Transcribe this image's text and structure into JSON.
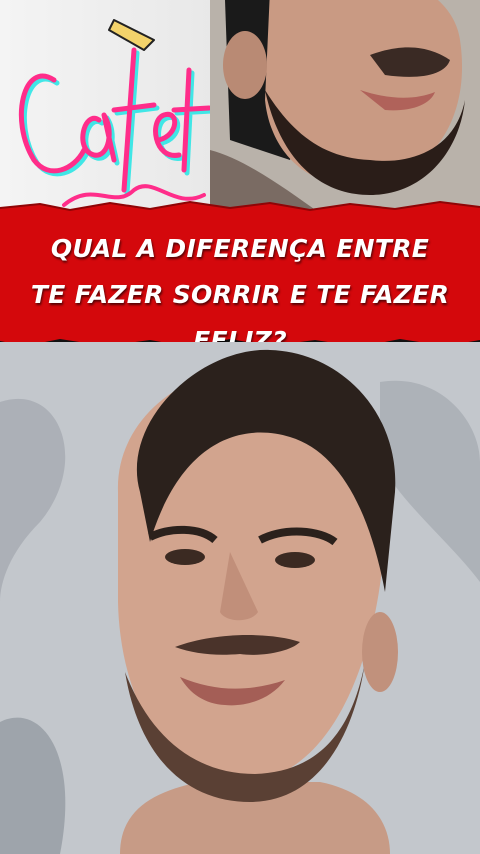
{
  "brand": {
    "text": "Cafeto"
  },
  "banner": {
    "line1": "QUAL A DIFERENÇA ENTRE",
    "line2": "TE FAZER SORRIR E TE FAZER FELIZ?"
  },
  "colors": {
    "banner_red": "#d4080c",
    "caption_text": "#ffffff",
    "brand_pink": "#ff2d8a",
    "brand_cyan": "#2ee6e6"
  }
}
